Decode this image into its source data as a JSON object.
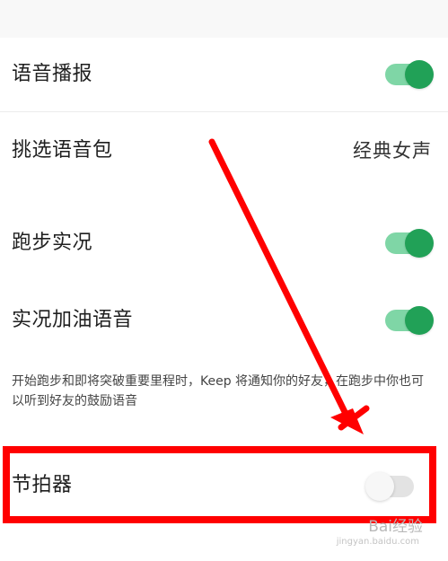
{
  "settings": {
    "voice_broadcast": {
      "label": "语音播报",
      "enabled": true
    },
    "voice_pack": {
      "label": "挑选语音包",
      "value": "经典女声"
    },
    "running_live": {
      "label": "跑步实况",
      "enabled": true
    },
    "live_cheer_voice": {
      "label": "实况加油语音",
      "enabled": true
    },
    "description": "开始跑步和即将突破重要里程时，Keep 将通知你的好友，在跑步中你也可以听到好友的鼓励语音",
    "metronome": {
      "label": "节拍器",
      "enabled": false
    }
  },
  "colors": {
    "toggle_on_track": "#7fd6a6",
    "toggle_on_knob": "#21a157",
    "toggle_off_track": "#e3e3e3",
    "annotation_red": "#ff0000"
  },
  "watermark": {
    "text": "Bai经验",
    "subtext": "jingyan.baidu.com"
  }
}
